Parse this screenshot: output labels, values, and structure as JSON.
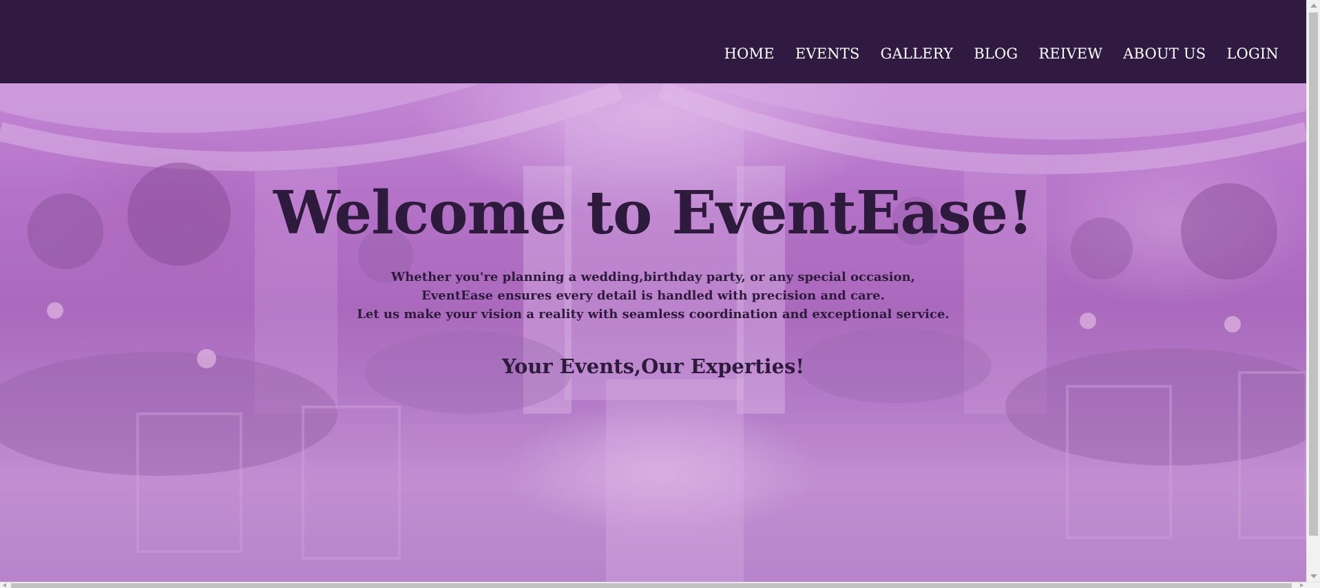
{
  "nav": {
    "items": [
      {
        "label": "HOME"
      },
      {
        "label": "EVENTS"
      },
      {
        "label": "GALLERY"
      },
      {
        "label": "BLOG"
      },
      {
        "label": "REIVEW"
      },
      {
        "label": "ABOUT US"
      },
      {
        "label": "LOGIN"
      }
    ]
  },
  "hero": {
    "title": "Welcome to EventEase!",
    "lines": [
      "Whether you're planning a wedding,birthday party, or any special occasion,",
      "EventEase ensures every detail is handled with precision and care.",
      "Let us make your vision a reality with seamless coordination and exceptional service."
    ],
    "tagline": "Your Events,Our Experties!"
  },
  "colors": {
    "navbar_bg": "#301a42",
    "nav_text": "#ffffff",
    "hero_text": "#2e1a3c",
    "hero_overlay": "#b574c8"
  }
}
